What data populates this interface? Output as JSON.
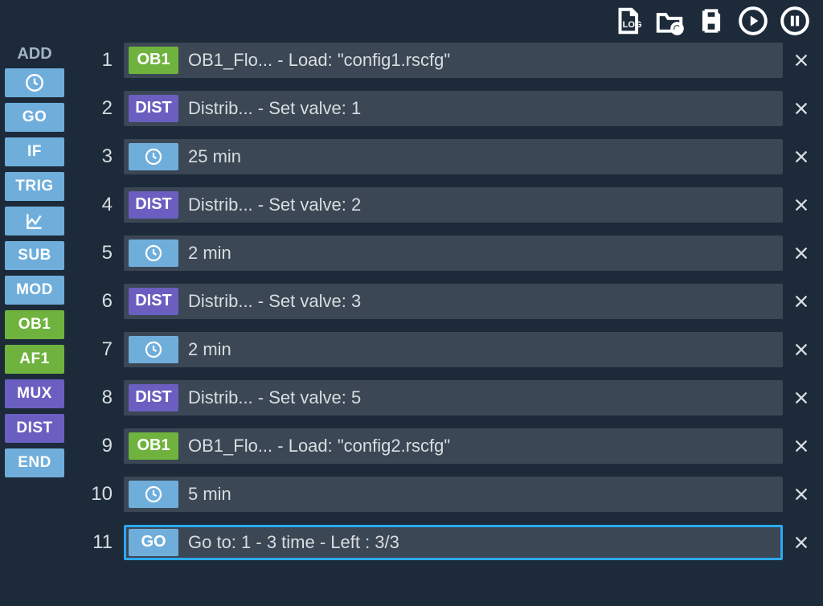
{
  "sidebar": {
    "title": "ADD",
    "items": [
      {
        "type": "icon",
        "name": "clock-icon",
        "color": "c-blue"
      },
      {
        "type": "label",
        "label": "GO",
        "color": "c-blue"
      },
      {
        "type": "label",
        "label": "IF",
        "color": "c-blue"
      },
      {
        "type": "label",
        "label": "TRIG",
        "color": "c-blue"
      },
      {
        "type": "icon",
        "name": "graph-icon",
        "color": "c-blue"
      },
      {
        "type": "label",
        "label": "SUB",
        "color": "c-blue"
      },
      {
        "type": "label",
        "label": "MOD",
        "color": "c-blue"
      },
      {
        "type": "label",
        "label": "OB1",
        "color": "c-green"
      },
      {
        "type": "label",
        "label": "AF1",
        "color": "c-green"
      },
      {
        "type": "label",
        "label": "MUX",
        "color": "c-purple"
      },
      {
        "type": "label",
        "label": "DIST",
        "color": "c-purple"
      },
      {
        "type": "label",
        "label": "END",
        "color": "c-blue"
      }
    ]
  },
  "toolbar": {
    "icons": [
      "log-icon",
      "new-folder-icon",
      "save-icon",
      "play-icon",
      "pause-icon"
    ]
  },
  "sequence": [
    {
      "num": "1",
      "chip_type": "label",
      "chip": "OB1",
      "chip_color": "c-green",
      "text": "OB1_Flo... - Load: \"config1.rscfg\"",
      "selected": false
    },
    {
      "num": "2",
      "chip_type": "label",
      "chip": "DIST",
      "chip_color": "c-purple",
      "text": "Distrib... - Set valve: 1",
      "selected": false
    },
    {
      "num": "3",
      "chip_type": "icon",
      "chip": "clock-icon",
      "chip_color": "c-blue",
      "text": "25 min",
      "selected": false
    },
    {
      "num": "4",
      "chip_type": "label",
      "chip": "DIST",
      "chip_color": "c-purple",
      "text": "Distrib... - Set valve: 2",
      "selected": false
    },
    {
      "num": "5",
      "chip_type": "icon",
      "chip": "clock-icon",
      "chip_color": "c-blue",
      "text": "2 min",
      "selected": false
    },
    {
      "num": "6",
      "chip_type": "label",
      "chip": "DIST",
      "chip_color": "c-purple",
      "text": "Distrib... - Set valve: 3",
      "selected": false
    },
    {
      "num": "7",
      "chip_type": "icon",
      "chip": "clock-icon",
      "chip_color": "c-blue",
      "text": "2 min",
      "selected": false
    },
    {
      "num": "8",
      "chip_type": "label",
      "chip": "DIST",
      "chip_color": "c-purple",
      "text": "Distrib... - Set valve: 5",
      "selected": false
    },
    {
      "num": "9",
      "chip_type": "label",
      "chip": "OB1",
      "chip_color": "c-green",
      "text": "OB1_Flo... - Load: \"config2.rscfg\"",
      "selected": false
    },
    {
      "num": "10",
      "chip_type": "icon",
      "chip": "clock-icon",
      "chip_color": "c-blue",
      "text": "5 min",
      "selected": false
    },
    {
      "num": "11",
      "chip_type": "label",
      "chip": "GO",
      "chip_color": "c-blue",
      "text": "Go to: 1 - 3 time - Left : 3/3",
      "selected": true
    }
  ],
  "colors": {
    "blue": "#6faedb",
    "purple": "#6a5fc0",
    "green": "#6fb33e",
    "bg": "#1c2a3a",
    "row": "#3b4754",
    "selection": "#2ca9f0"
  }
}
